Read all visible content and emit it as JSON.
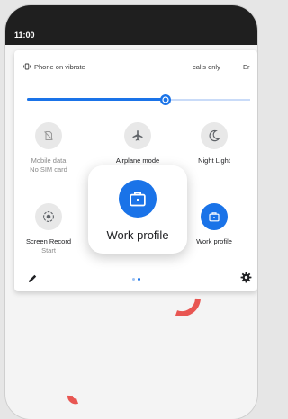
{
  "status_bar": {
    "time": "11:00"
  },
  "quick_settings": {
    "vibrate_label": "Phone on vibrate",
    "dnd_label": "calls only",
    "truncated_label": "Er",
    "brightness_level": 0.62
  },
  "tiles": [
    {
      "label": "Mobile data",
      "sublabel": "No SIM card",
      "icon": "no-sim-icon",
      "active": false
    },
    {
      "label": "Airplane mode",
      "sublabel": "",
      "icon": "airplane-icon",
      "active": false
    },
    {
      "label": "Night Light",
      "sublabel": "",
      "icon": "moon-icon",
      "active": false
    },
    {
      "label": "Screen Record",
      "sublabel": "Start",
      "icon": "screen-record-icon",
      "active": false
    },
    {
      "label": "Work profile",
      "sublabel": "",
      "icon": "briefcase-icon",
      "active": true
    }
  ],
  "popup": {
    "label": "Work profile",
    "icon": "briefcase-icon"
  },
  "pager": {
    "pages": 2,
    "current": 2
  },
  "colors": {
    "accent": "#1a73e8",
    "status_bar": "#1f1f1f",
    "wallpaper_accent": "#e53935"
  }
}
